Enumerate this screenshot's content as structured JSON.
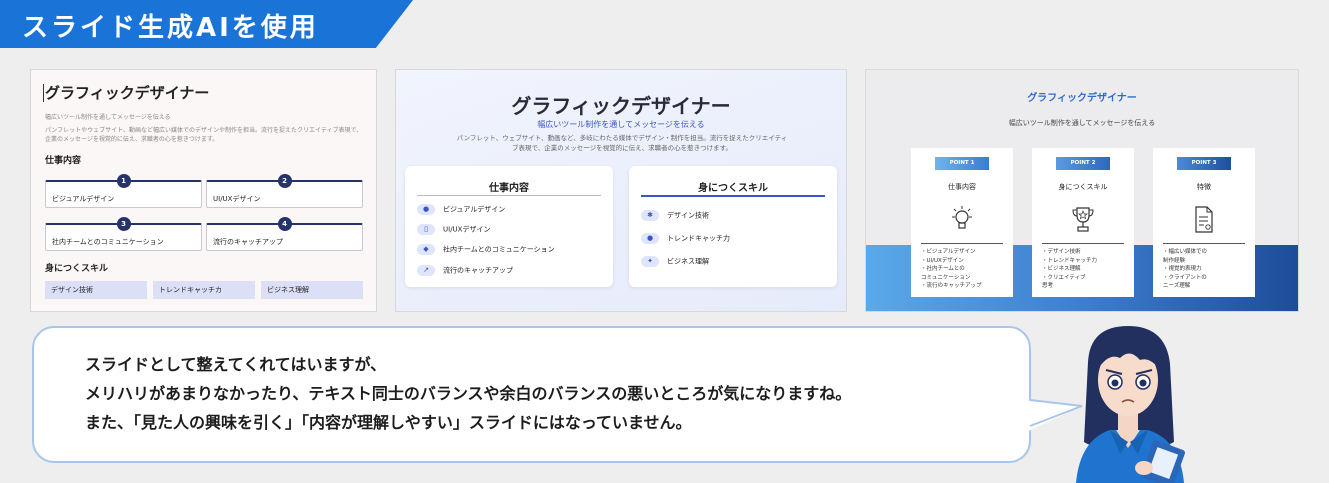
{
  "banner": {
    "title": "スライド生成AIを使用"
  },
  "slide1": {
    "title": "グラフィックデザイナー",
    "subtitle": "幅広いツール制作を通してメッセージを伝える",
    "description": "パンフレットやウェブサイト、動画など幅広い媒体でのデザインや制作を担当。流行を捉えたクリエイティブ表現で、企業のメッセージを視覚的に伝え、求職者の心を惹きつけます。",
    "section_work": "仕事内容",
    "items": [
      {
        "num": "1",
        "label": "ビジュアルデザイン"
      },
      {
        "num": "2",
        "label": "UI/UXデザイン"
      },
      {
        "num": "3",
        "label": "社内チームとのコミュニケーション"
      },
      {
        "num": "4",
        "label": "流行のキャッチアップ"
      }
    ],
    "section_skills": "身につくスキル",
    "skills": [
      "デザイン技術",
      "トレンドキャッチカ",
      "ビジネス理解"
    ]
  },
  "slide2": {
    "title": "グラフィックデザイナー",
    "subtitle": "幅広いツール制作を通してメッセージを伝える",
    "description": "パンフレット、ウェブサイト、動画など、多岐にわたる媒体でデザイン・制作を担当。流行を捉えたクリエイティブ表現で、企業のメッセージを視覚的に伝え、求職者の心を惹きつけます。",
    "work_title": "仕事内容",
    "work_items": [
      "ビジュアルデザイン",
      "UI/UXデザイン",
      "社内チームとのコミュニケーション",
      "流行のキャッチアップ"
    ],
    "skill_title": "身につくスキル",
    "skill_items": [
      "デザイン技術",
      "トレンドキャッチ力",
      "ビジネス理解"
    ],
    "colors": {
      "accent": "#3a55c7"
    }
  },
  "slide3": {
    "title": "グラフィックデザイナー",
    "subtitle": "幅広いツール制作を通してメッセージを伝える",
    "points": [
      {
        "badge": "POINT 1",
        "title": "仕事内容",
        "icon": "lightbulb-icon",
        "lines": [
          "・ビジュアルデザイン",
          "・UI/UXデザイン",
          "・社内チームとの",
          "コミュニケーション",
          "・流行のキャッチアップ"
        ]
      },
      {
        "badge": "POINT 2",
        "title": "身につくスキル",
        "icon": "trophy-icon",
        "lines": [
          "・デザイン技術",
          "・トレンドキャッチ力",
          "・ビジネス理解",
          "・クリエイティブ",
          "思考"
        ]
      },
      {
        "badge": "POINT 3",
        "title": "特徴",
        "icon": "document-icon",
        "lines": [
          "・幅広い媒体での",
          "制作経験",
          "・視覚的表現力",
          "・クライアントの",
          "ニーズ理解"
        ]
      }
    ]
  },
  "bubble": {
    "lines": [
      "スライドとして整えてくれてはいますが、",
      "メリハリがあまりなかったり、テキスト同士のバランスや余白のバランスの悪いところが気になりますね。",
      "また、「見た人の興味を引く」「内容が理解しやすい」スライドにはなっていません。"
    ]
  }
}
